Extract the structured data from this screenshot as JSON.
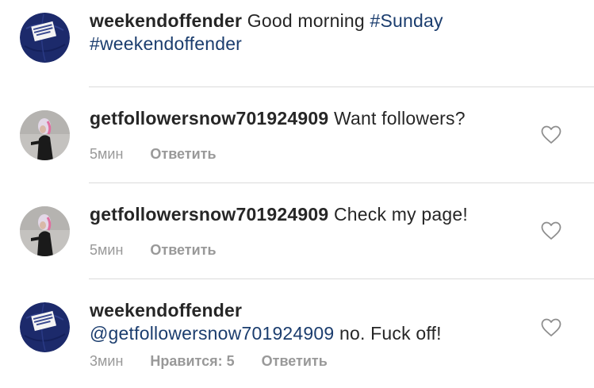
{
  "caption": {
    "username": "weekendoffender",
    "text": "Good morning",
    "tags": [
      "#Sunday",
      "#weekendoffender"
    ]
  },
  "comments": [
    {
      "username": "getfollowersnow701924909",
      "text": "Want followers?",
      "time": "5мин",
      "reply_label": "Ответить"
    },
    {
      "username": "getfollowersnow701924909",
      "text": "Check my page!",
      "time": "5мин",
      "reply_label": "Ответить"
    },
    {
      "username": "weekendoffender",
      "mention": "@getfollowersnow701924909",
      "text": "no. Fuck off!",
      "time": "3мин",
      "likes_label": "Нравится: 5",
      "reply_label": "Ответить"
    }
  ],
  "avatars": {
    "weekendoffender_ball": "#1c2a6b",
    "weekendoffender_label": "WEEKEND OFFENDER",
    "getfollowers_bg": "#bfbdba",
    "getfollowers_hair": "#e0d7e6",
    "getfollowers_dress": "#1a1a1a"
  },
  "icons": {
    "like": "heart-outline-icon"
  }
}
